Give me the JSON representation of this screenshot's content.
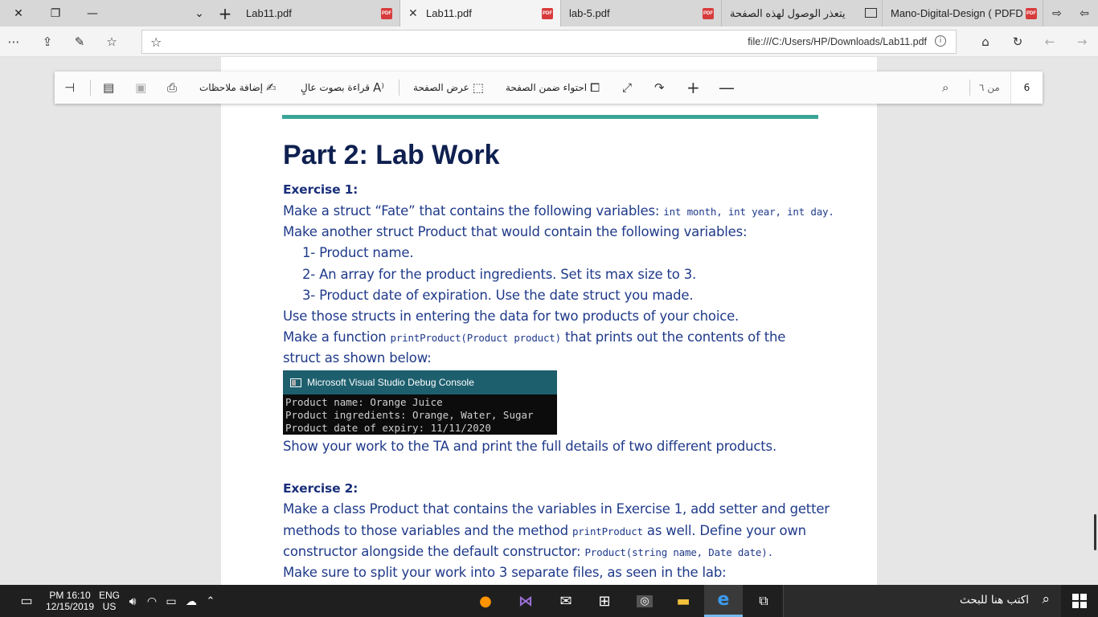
{
  "window": {
    "tabs": [
      {
        "label": "Lab11.pdf",
        "icon": "pdf-icon"
      },
      {
        "label": "Lab11.pdf",
        "icon": "pdf-icon",
        "active": true
      },
      {
        "label": "lab-5.pdf",
        "icon": "pdf-icon"
      },
      {
        "label": "يتعذر الوصول لهذه الصفحة",
        "icon": "page-icon"
      },
      {
        "label": "Mano-Digital-Design ( PDFD",
        "icon": "pdf-icon"
      }
    ]
  },
  "address": {
    "url": "file:///C:/Users/HP/Downloads/Lab11.pdf"
  },
  "pdf_toolbar": {
    "add_notes": "إضافة ملاحظات",
    "read_aloud": "قراءة بصوت عالٍ",
    "page_view": "عرض الصفحة",
    "fit_page": "احتواء ضمن الصفحة",
    "page_of": "من ٦",
    "current_page": "6"
  },
  "document": {
    "heading": "Part 2: Lab Work",
    "ex1_title": "Exercise 1:",
    "ex1_l1_text": "Make a struct “Fate” that contains the following variables: ",
    "ex1_l1_code": "int month, int year, int day.",
    "ex1_l2": "Make another struct Product that would contain the following variables:",
    "ex1_items": [
      "1-  Product name.",
      "2-  An array for the product ingredients. Set its max size to 3.",
      "3-  Product date of expiration. Use the date struct you made."
    ],
    "ex1_l3": "Use those structs in entering the data for two products of your choice.",
    "ex1_l4_text": "Make a function ",
    "ex1_l4_code": "printProduct(Product product)",
    "ex1_l4_rest": "  that prints out the contents of the",
    "ex1_l5": "struct as shown below:",
    "console": {
      "title": "Microsoft Visual Studio Debug Console",
      "lines": [
        "Product name: Orange Juice",
        "Product ingredients: Orange, Water, Sugar",
        "Product date of expiry: 11/11/2020"
      ]
    },
    "ex1_l6": "Show your work to the TA and print the full details of two different products.",
    "ex2_title": "Exercise 2:",
    "ex2_l1": "Make a class Product that contains the variables in Exercise 1, add setter and getter",
    "ex2_l2_text": "methods to those variables and the method ",
    "ex2_l2_code": "printProduct",
    "ex2_l2_rest": " as well. Define your own",
    "ex2_l3_text": "constructor alongside the default constructor: ",
    "ex2_l3_code": "Product(string name, Date date).",
    "ex2_l4": "Make sure to split your work into 3 separate files, as seen in the lab:"
  },
  "taskbar": {
    "time": "PM 16:10",
    "date": "12/15/2019",
    "lang_top": "ENG",
    "lang_bottom": "US",
    "search_placeholder": "اكتب هنا للبحث"
  }
}
